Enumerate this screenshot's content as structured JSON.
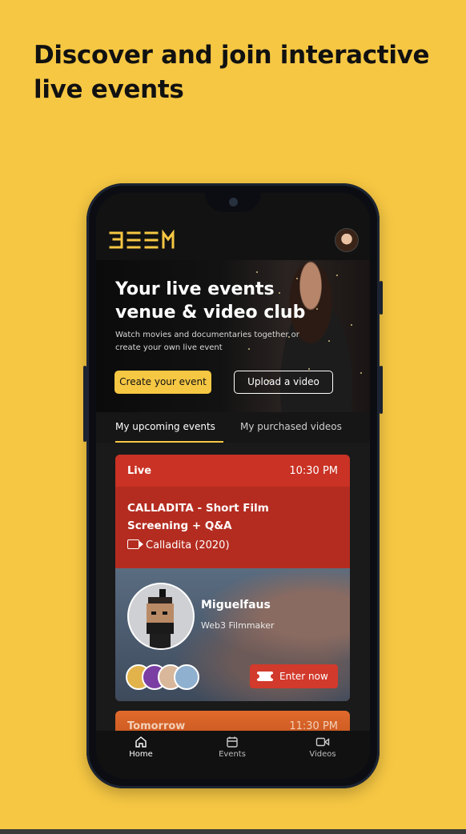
{
  "headline": "Discover and join interactive live events",
  "app": {
    "logo_text": "BEEM",
    "hero": {
      "title": "Your live events venue & video club",
      "subtitle": "Watch movies and documentaries together or create your own live event",
      "create_button": "Create your event",
      "upload_button": "Upload a video"
    },
    "tabs": [
      "My upcoming events",
      "My purchased videos"
    ],
    "event_card": {
      "status": "Live",
      "time": "10:30 PM",
      "title": "CALLADITA - Short Film Screening + Q&A",
      "film": "Calladita (2020)",
      "host_name": "Miguelfaus",
      "host_role": "Web3 Filmmaker",
      "enter_button": "Enter now"
    },
    "next_card": {
      "status": "Tomorrow",
      "time": "11:30 PM"
    },
    "bottom_nav": [
      "Home",
      "Events",
      "Videos"
    ]
  },
  "colors": {
    "brand_yellow": "#F6C743",
    "live_red": "#C93224",
    "tomorrow_orange": "#E06A2B"
  }
}
